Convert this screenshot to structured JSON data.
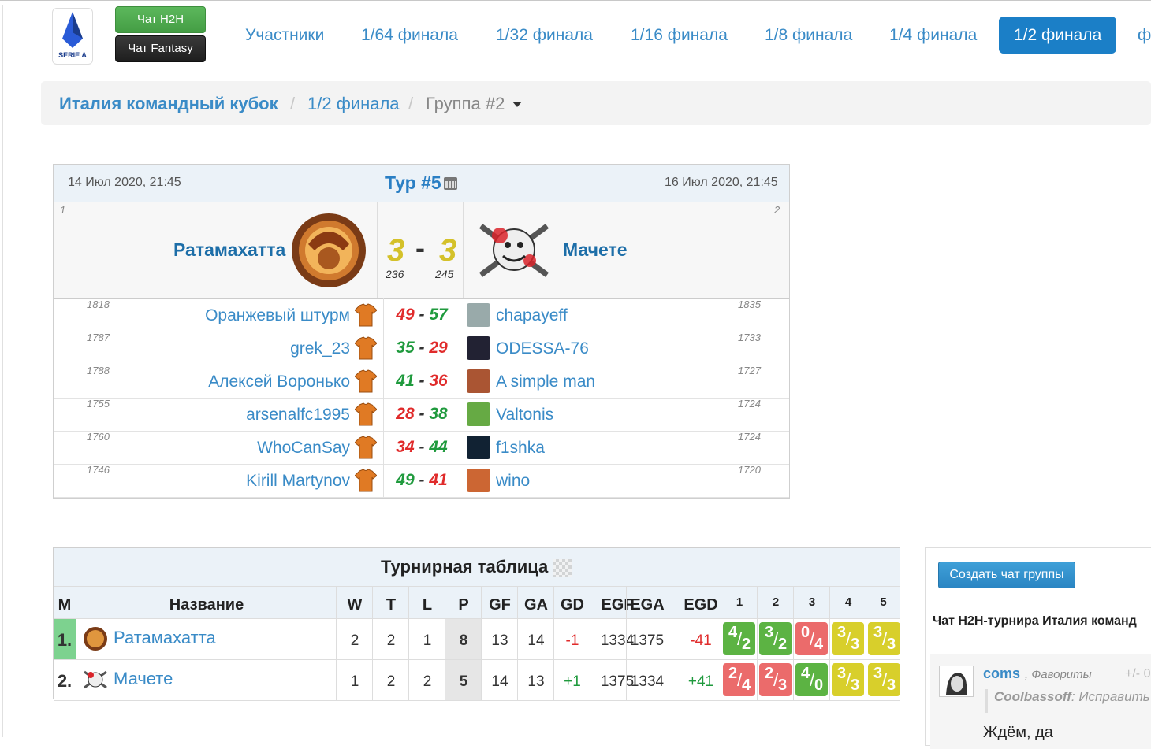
{
  "header": {
    "logo_text": "SERIE A",
    "chat_h2h": "Чат H2H",
    "chat_fantasy": "Чат Fantasy",
    "nav": [
      "Участники",
      "1/64 финала",
      "1/32 финала",
      "1/16 финала",
      "1/8 финала",
      "1/4 финала",
      "1/2 финала",
      "ф"
    ],
    "nav_active_index": 6
  },
  "breadcrumb": {
    "root": "Италия командный кубок",
    "stage": "1/2 финала",
    "current": "Группа #2",
    "sep": "/"
  },
  "match": {
    "date_left": "14 Июл 2020, 21:45",
    "date_right": "16 Июл 2020, 21:45",
    "tour": "Тур #5",
    "home": {
      "num": "1",
      "name": "Ратамахатта",
      "score": "3",
      "points": "236"
    },
    "away": {
      "num": "2",
      "name": "Мачете",
      "score": "3",
      "points": "245"
    },
    "dash": "-",
    "players": [
      {
        "home_rating": "1818",
        "home_name": "Оранжевый штурм",
        "home_score": "49",
        "away_score": "57",
        "away_name": "chapayeff",
        "away_rating": "1835",
        "home_win": false
      },
      {
        "home_rating": "1787",
        "home_name": "grek_23",
        "home_score": "35",
        "away_score": "29",
        "away_name": "ODESSA-76",
        "away_rating": "1733",
        "home_win": true
      },
      {
        "home_rating": "1788",
        "home_name": "Алексей Воронько",
        "home_score": "41",
        "away_score": "36",
        "away_name": "A simple man",
        "away_rating": "1727",
        "home_win": true
      },
      {
        "home_rating": "1755",
        "home_name": "arsenalfc1995",
        "home_score": "28",
        "away_score": "38",
        "away_name": "Valtonis",
        "away_rating": "1724",
        "home_win": false
      },
      {
        "home_rating": "1760",
        "home_name": "WhoCanSay",
        "home_score": "34",
        "away_score": "44",
        "away_name": "f1shka",
        "away_rating": "1724",
        "home_win": false
      },
      {
        "home_rating": "1746",
        "home_name": "Kirill Martynov",
        "home_score": "49",
        "away_score": "41",
        "away_name": "wino",
        "away_rating": "1720",
        "home_win": true
      }
    ]
  },
  "standings": {
    "title": "Турнирная таблица",
    "columns": [
      "М",
      "Название",
      "W",
      "T",
      "L",
      "P",
      "GF",
      "GA",
      "GD",
      "EGF",
      "EGA",
      "EGD",
      "1",
      "2",
      "3",
      "4",
      "5"
    ],
    "rows": [
      {
        "pos": "1.",
        "name": "Ратамахатта",
        "W": "2",
        "T": "2",
        "L": "1",
        "P": "8",
        "GF": "13",
        "GA": "14",
        "GD": "-1",
        "EGF": "1334",
        "EGA": "1375",
        "EGD": "-41",
        "rounds": [
          {
            "a": "4",
            "b": "2",
            "r": "w"
          },
          {
            "a": "3",
            "b": "2",
            "r": "w"
          },
          {
            "a": "0",
            "b": "4",
            "r": "l"
          },
          {
            "a": "3",
            "b": "3",
            "r": "d"
          },
          {
            "a": "3",
            "b": "3",
            "r": "d"
          }
        ]
      },
      {
        "pos": "2.",
        "name": "Мачете",
        "W": "1",
        "T": "2",
        "L": "2",
        "P": "5",
        "GF": "14",
        "GA": "13",
        "GD": "+1",
        "EGF": "1375",
        "EGA": "1334",
        "EGD": "+41",
        "rounds": [
          {
            "a": "2",
            "b": "4",
            "r": "l"
          },
          {
            "a": "2",
            "b": "3",
            "r": "l"
          },
          {
            "a": "4",
            "b": "0",
            "r": "w"
          },
          {
            "a": "3",
            "b": "3",
            "r": "d"
          },
          {
            "a": "3",
            "b": "3",
            "r": "d"
          }
        ]
      }
    ]
  },
  "chat": {
    "create_button": "Создать чат группы",
    "title": "Чат H2H-турнира Италия команд",
    "message": {
      "user": "coms",
      "tag": ", Фавориты",
      "votes": "+/- 0",
      "quote_user": "Coolbassoff",
      "quote_text": ": Исправить",
      "text": "Ждём, да"
    }
  },
  "colors": {
    "accent": "#1b7fc7",
    "link": "#3a8bc7",
    "win": "#1f9a3d",
    "lose": "#e02b2b",
    "draw_badge": "#d8cf2b"
  }
}
